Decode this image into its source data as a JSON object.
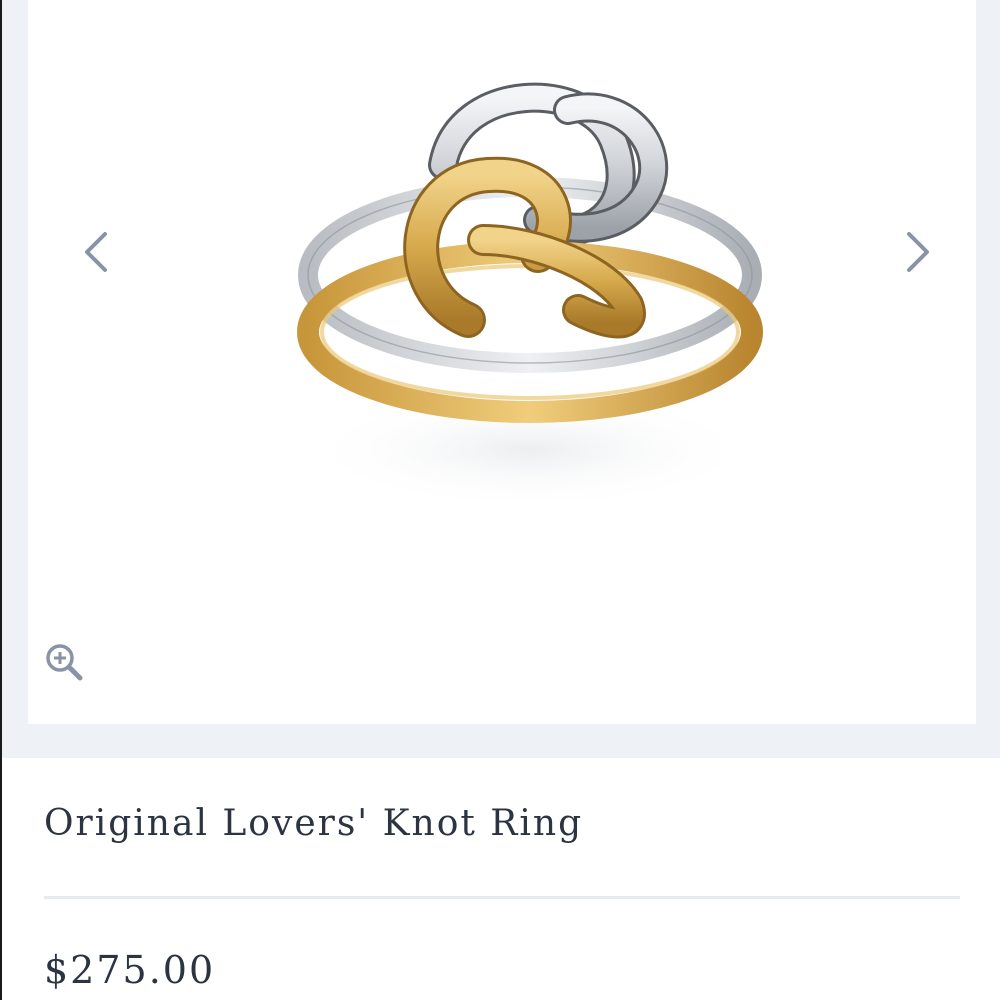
{
  "gallery": {
    "image_subject": "ring",
    "prev_icon": "chevron-left-icon",
    "next_icon": "chevron-right-icon",
    "zoom_icon": "zoom-in-icon"
  },
  "product": {
    "title": "Original Lovers' Knot Ring",
    "price": "$275.00"
  },
  "colors": {
    "band_background": "#eef1f6",
    "text": "#2c3442",
    "icon": "#8a93a6",
    "gold": "#d4a84a",
    "silver": "#c9ccd1"
  }
}
